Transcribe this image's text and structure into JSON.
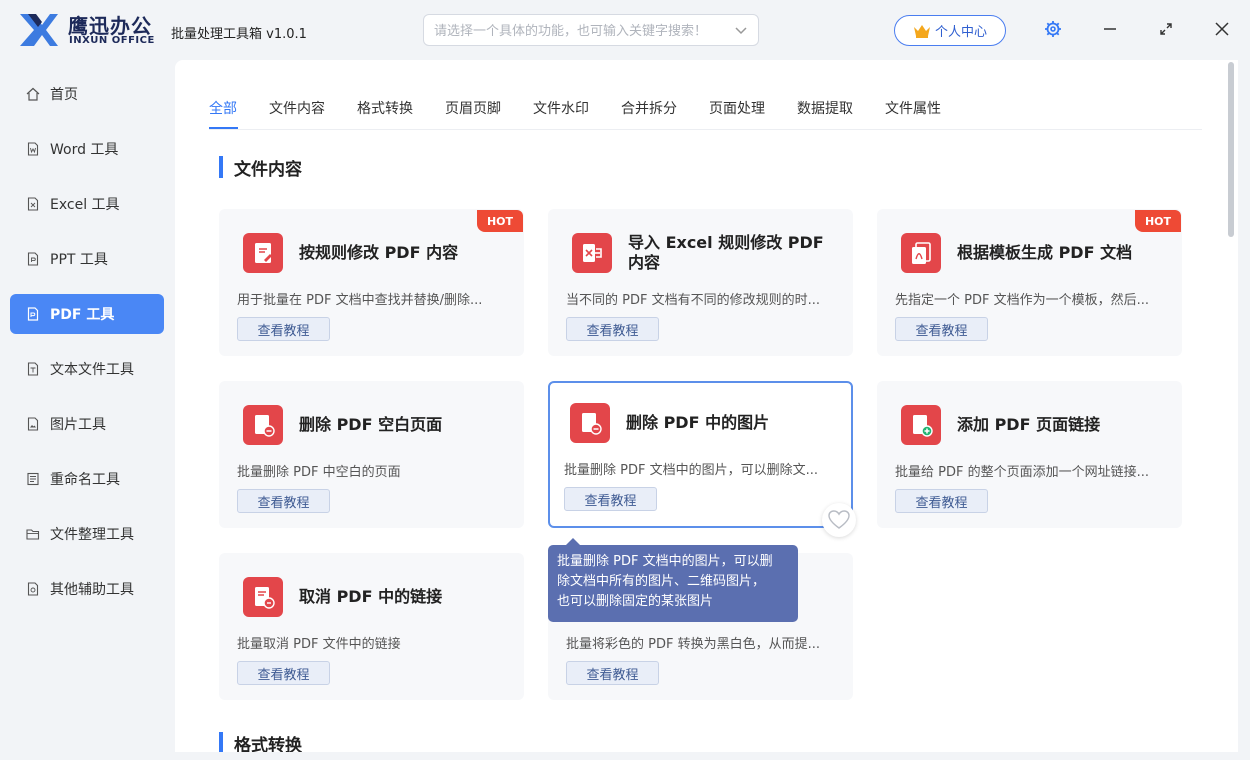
{
  "header": {
    "brand_cn": "鹰迅办公",
    "brand_en": "INXUN OFFICE",
    "app_title": "批量处理工具箱 v1.0.1",
    "search_placeholder": "请选择一个具体的功能，也可输入关键字搜索！",
    "user_center": "个人中心",
    "accent_color": "#3478f6"
  },
  "sidebar": {
    "items": [
      {
        "label": "首页",
        "icon": "home-icon"
      },
      {
        "label": "Word 工具",
        "icon": "word-file-icon"
      },
      {
        "label": "Excel 工具",
        "icon": "excel-file-icon"
      },
      {
        "label": "PPT 工具",
        "icon": "ppt-file-icon"
      },
      {
        "label": "PDF 工具",
        "icon": "pdf-file-icon",
        "active": true
      },
      {
        "label": "文本文件工具",
        "icon": "text-file-icon"
      },
      {
        "label": "图片工具",
        "icon": "image-file-icon"
      },
      {
        "label": "重命名工具",
        "icon": "rename-icon"
      },
      {
        "label": "文件整理工具",
        "icon": "folder-icon"
      },
      {
        "label": "其他辅助工具",
        "icon": "misc-tools-icon"
      }
    ]
  },
  "tabs": [
    "全部",
    "文件内容",
    "格式转换",
    "页眉页脚",
    "文件水印",
    "合并拆分",
    "页面处理",
    "数据提取",
    "文件属性"
  ],
  "sections": {
    "file_content": "文件内容",
    "format_convert": "格式转换"
  },
  "cards": [
    {
      "title": "按规则修改 PDF 内容",
      "desc": "用于批量在 PDF 文档中查找并替换/删除...",
      "btn": "查看教程",
      "hot": "HOT"
    },
    {
      "title": "导入 Excel 规则修改 PDF 内容",
      "desc": "当不同的 PDF 文档有不同的修改规则的时...",
      "btn": "查看教程"
    },
    {
      "title": "根据模板生成 PDF 文档",
      "desc": "先指定一个 PDF 文档作为一个模板，然后...",
      "btn": "查看教程",
      "hot": "HOT"
    },
    {
      "title": "删除 PDF 空白页面",
      "desc": "批量删除 PDF 中空白的页面",
      "btn": "查看教程"
    },
    {
      "title": "删除 PDF 中的图片",
      "desc": "批量删除 PDF 文档中的图片，可以删除文...",
      "btn": "查看教程"
    },
    {
      "title": "添加 PDF 页面链接",
      "desc": "批量给 PDF 的整个页面添加一个网址链接...",
      "btn": "查看教程"
    },
    {
      "title": "取消 PDF 中的链接",
      "desc": "批量取消 PDF 文件中的链接",
      "btn": "查看教程"
    },
    {
      "title": "",
      "desc": "批量将彩色的 PDF 转换为黑白色，从而提...",
      "btn": "查看教程"
    }
  ],
  "tooltip": {
    "line1": "批量删除 PDF 文档中的图片，可以删",
    "line2": "除文档中所有的图片、二维码图片，",
    "line3": "也可以删除固定的某张图片"
  }
}
